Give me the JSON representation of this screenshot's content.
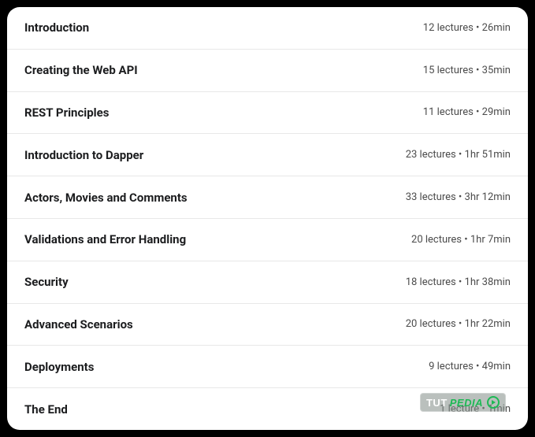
{
  "sections": [
    {
      "title": "Introduction",
      "meta": "12 lectures • 26min"
    },
    {
      "title": "Creating the Web API",
      "meta": "15 lectures • 35min"
    },
    {
      "title": "REST Principles",
      "meta": "11 lectures • 29min"
    },
    {
      "title": "Introduction to Dapper",
      "meta": "23 lectures • 1hr 51min"
    },
    {
      "title": "Actors, Movies and Comments",
      "meta": "33 lectures • 3hr 12min"
    },
    {
      "title": "Validations and Error Handling",
      "meta": "20 lectures • 1hr 7min"
    },
    {
      "title": "Security",
      "meta": "18 lectures • 1hr 38min"
    },
    {
      "title": "Advanced Scenarios",
      "meta": "20 lectures • 1hr 22min"
    },
    {
      "title": "Deployments",
      "meta": "9 lectures • 49min"
    },
    {
      "title": "The End",
      "meta": "1 lecture • 1min"
    }
  ],
  "watermark": {
    "part1": "TUT",
    "part2": "PEDIA"
  }
}
